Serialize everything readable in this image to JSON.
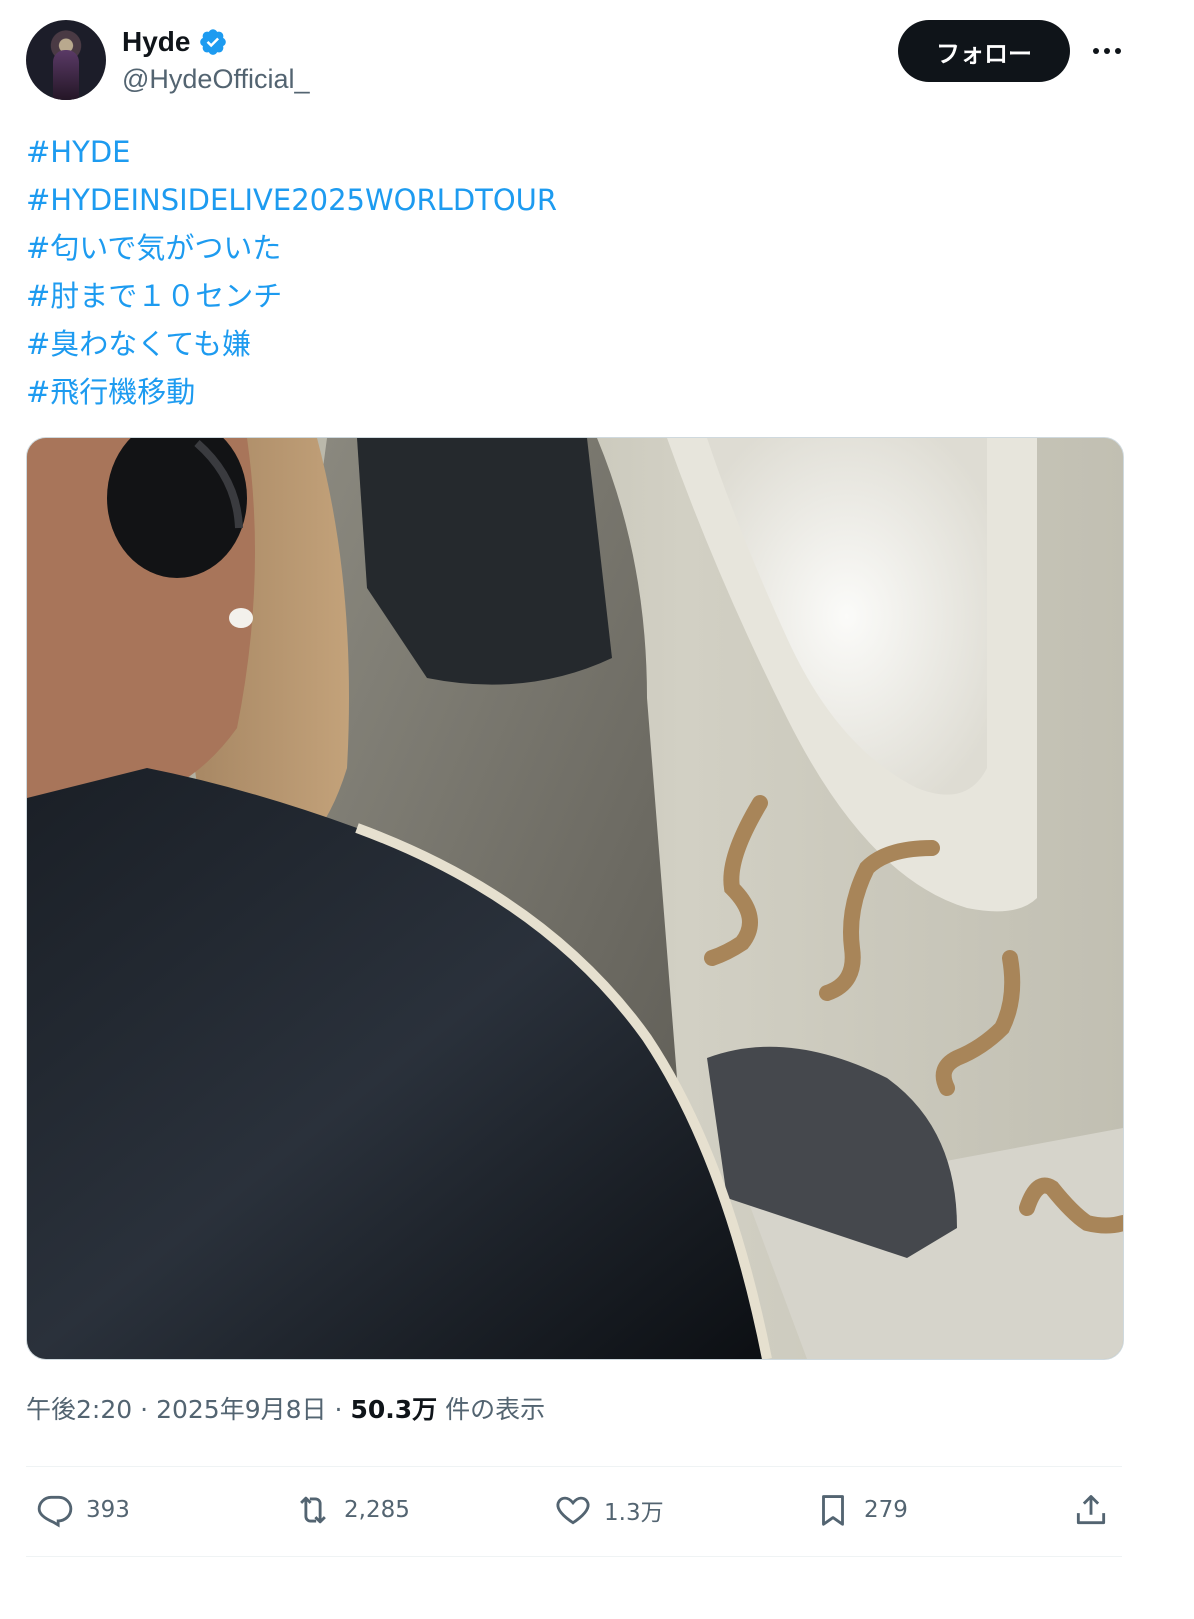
{
  "user": {
    "display_name": "Hyde",
    "handle": "@HydeOfficial_",
    "verified": true,
    "follow_label": "フォロー"
  },
  "hashtags": [
    "#HYDE",
    "#HYDEINSIDELIVE2025WORLDTOUR",
    "#匂いで気がついた",
    "#肘まで１０センチ",
    "#臭わなくても嫌",
    "#飛行機移動"
  ],
  "meta": {
    "time": "午後2:20",
    "separator": "·",
    "date": "2025年9月8日",
    "views_count": "50.3万",
    "views_suffix": "件の表示"
  },
  "actions": {
    "replies": "393",
    "reposts": "2,285",
    "likes": "1.3万",
    "bookmarks": "279"
  },
  "icons": {
    "verified": "verified-badge-icon",
    "more": "more-dots-icon",
    "reply": "reply-bubble-icon",
    "repost": "repost-arrows-icon",
    "like": "heart-icon",
    "bookmark": "bookmark-icon",
    "share": "share-upload-icon"
  },
  "colors": {
    "link": "#1d9bf0",
    "text": "#0f1419",
    "secondary": "#536471",
    "button": "#0f1419"
  }
}
